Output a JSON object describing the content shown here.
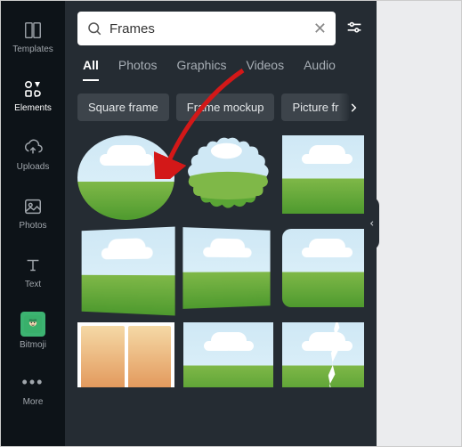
{
  "rail": {
    "items": [
      {
        "label": "Templates"
      },
      {
        "label": "Elements"
      },
      {
        "label": "Uploads"
      },
      {
        "label": "Photos"
      },
      {
        "label": "Text"
      },
      {
        "label": "Bitmoji"
      },
      {
        "label": "More"
      }
    ]
  },
  "search": {
    "value": "Frames"
  },
  "tabs": [
    {
      "label": "All",
      "active": true
    },
    {
      "label": "Photos"
    },
    {
      "label": "Graphics"
    },
    {
      "label": "Videos"
    },
    {
      "label": "Audio"
    }
  ],
  "chips": [
    {
      "label": "Square frame"
    },
    {
      "label": "Frame mockup"
    },
    {
      "label": "Picture fr"
    }
  ],
  "frames": [
    {
      "shape": "circle"
    },
    {
      "shape": "scallop"
    },
    {
      "shape": "square"
    },
    {
      "shape": "skew1"
    },
    {
      "shape": "skew2"
    },
    {
      "shape": "rounded"
    },
    {
      "shape": "polaroid"
    },
    {
      "shape": "square"
    },
    {
      "shape": "torn"
    }
  ]
}
